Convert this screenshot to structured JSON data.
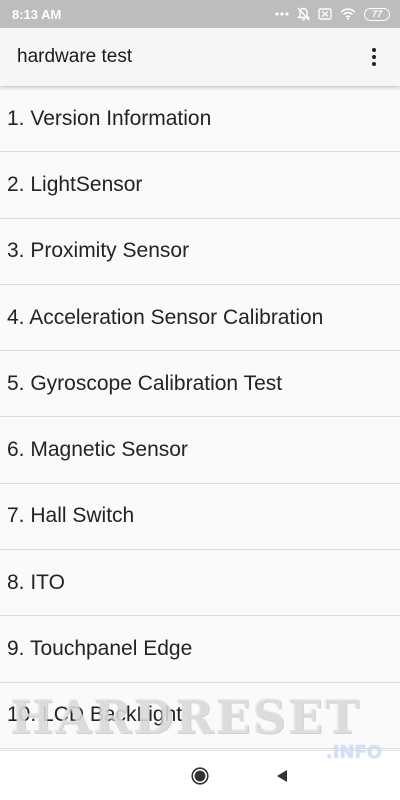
{
  "status_bar": {
    "time": "8:13 AM",
    "battery_level": "77",
    "icons": [
      "more-dots-icon",
      "notifications-off-icon",
      "sim-disabled-icon",
      "wifi-icon",
      "battery-icon"
    ]
  },
  "app_bar": {
    "title": "hardware test",
    "menu_icon": "more-vert-icon"
  },
  "tests": [
    {
      "label": "1. Version Information"
    },
    {
      "label": "2. LightSensor"
    },
    {
      "label": "3. Proximity Sensor"
    },
    {
      "label": "4. Acceleration Sensor Calibration"
    },
    {
      "label": "5. Gyroscope Calibration Test"
    },
    {
      "label": "6. Magnetic Sensor"
    },
    {
      "label": "7. Hall Switch"
    },
    {
      "label": "8. ITO"
    },
    {
      "label": "9. Touchpanel Edge"
    },
    {
      "label": "10. LCD BackLight"
    }
  ],
  "watermark": {
    "main": "HARDRESET",
    "sub": ".INFO"
  },
  "nav_bar": {
    "buttons": [
      "home-button",
      "back-button"
    ]
  },
  "colors": {
    "status_bar_bg": "#bdbdbd",
    "app_bar_bg": "#f6f6f6",
    "list_bg": "#fafafa",
    "divider": "#dcdcdc",
    "text": "#232323"
  }
}
